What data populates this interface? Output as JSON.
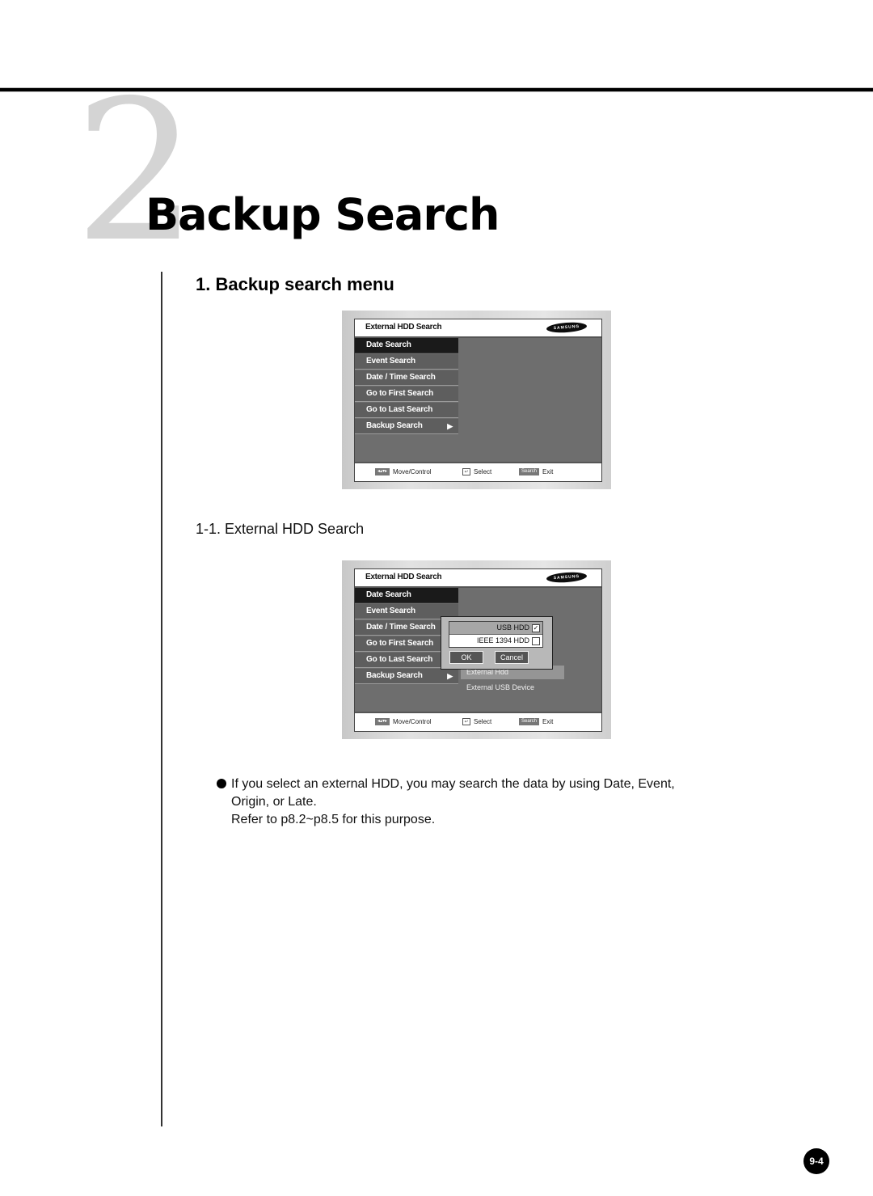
{
  "chapter": {
    "number": "2",
    "title": "Backup Search"
  },
  "section": {
    "heading": "1. Backup search menu",
    "subheading": "1-1. External HDD Search"
  },
  "screens": [
    {
      "title": "External HDD Search",
      "logo": "SAMSUNG",
      "menu": [
        {
          "label": "Date  Search",
          "active": true
        },
        {
          "label": "Event Search"
        },
        {
          "label": "Date / Time Search"
        },
        {
          "label": "Go to First Search"
        },
        {
          "label": "Go to Last Search"
        },
        {
          "label": "Backup  Search",
          "arrow": "▶"
        }
      ],
      "status": {
        "move_icon": "move-arrows-icon",
        "move_label": "Move/Control",
        "select_icon": "enter-icon",
        "select_label": "Select",
        "search_key": "Search",
        "exit_label": "Exit"
      }
    },
    {
      "title": "External HDD Search",
      "logo": "SAMSUNG",
      "menu": [
        {
          "label": "Date  Search",
          "active": true
        },
        {
          "label": "Event Search"
        },
        {
          "label": "Date / Time Search"
        },
        {
          "label": "Go to First Search"
        },
        {
          "label": "Go to Last Search"
        },
        {
          "label": "Backup  Search",
          "arrow": "▶"
        }
      ],
      "dialog": {
        "options": [
          {
            "label": "USB HDD",
            "checked": true,
            "mark": "✓"
          },
          {
            "label": "IEEE 1394 HDD",
            "checked": false,
            "mark": ""
          }
        ],
        "ok_label": "OK",
        "cancel_label": "Cancel"
      },
      "submenu": [
        {
          "label": "External Hdd",
          "highlighted": true
        },
        {
          "label": "External USB Device"
        }
      ],
      "status": {
        "move_icon": "move-arrows-icon",
        "move_label": "Move/Control",
        "select_icon": "enter-icon",
        "select_label": "Select",
        "search_key": "Search",
        "exit_label": "Exit"
      }
    }
  ],
  "body": {
    "line1": "If you select an external HDD, you may search the data by using Date, Event,",
    "line2": "Origin, or Late.",
    "line3": "Refer to p8.2~p8.5 for this purpose."
  },
  "page_number": "9-4"
}
